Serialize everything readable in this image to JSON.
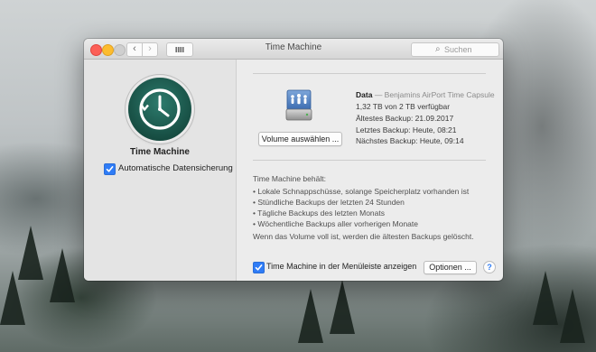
{
  "window": {
    "title": "Time Machine",
    "search_placeholder": "Suchen",
    "nav_back_icon": "chevron-left-icon",
    "nav_forward_icon": "chevron-right-icon",
    "show_all_icon": "grid-icon"
  },
  "left": {
    "app_name": "Time Machine",
    "auto_backup_label": "Automatische Datensicherung",
    "auto_backup_checked": true
  },
  "disk": {
    "select_button": "Volume auswählen ...",
    "name": "Data",
    "location": "— Benjamins AirPort Time Capsule",
    "free_space": "1,32 TB von 2 TB verfügbar",
    "oldest_backup": "Ältestes Backup: 21.09.2017",
    "latest_backup": "Letztes Backup: Heute, 08:21",
    "next_backup": "Nächstes Backup: Heute, 09:14"
  },
  "keeps": {
    "heading": "Time Machine behält:",
    "items": [
      "• Lokale Schnappschüsse, solange Speicherplatz vorhanden ist",
      "• Stündliche Backups der letzten 24 Stunden",
      "• Tägliche Backups des letzten Monats",
      "• Wöchentliche Backups aller vorherigen Monate"
    ],
    "footer": "Wenn das Volume voll ist, werden die ältesten Backups gelöscht."
  },
  "bottom": {
    "menubar_label": "Time Machine in der Menüleiste anzeigen",
    "menubar_checked": true,
    "options_button": "Optionen ...",
    "help_button": "?"
  },
  "colors": {
    "accent": "#2f7cf6",
    "close": "#fc5f57",
    "minimize": "#fdbc2e",
    "icon_green": "#174e43"
  }
}
